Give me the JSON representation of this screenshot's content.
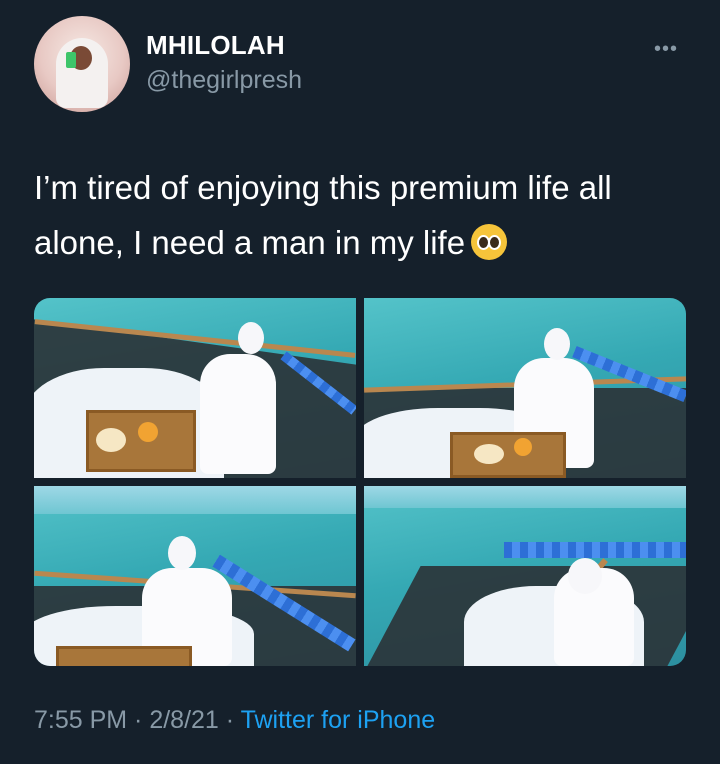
{
  "user": {
    "display_name": "MHILOLAH",
    "handle": "@thegirlpresh",
    "avatar_icon": "profile-photo"
  },
  "menu": {
    "more_icon": "more-dots-icon",
    "more_glyph": "•••"
  },
  "tweet": {
    "text": "I’m tired of enjoying this premium life all alone, I need a man in my life",
    "emoji_icon": "pleading-face-emoji"
  },
  "media": {
    "photos": [
      {
        "description_icon": "photo-floating-breakfast-1"
      },
      {
        "description_icon": "photo-floating-breakfast-2"
      },
      {
        "description_icon": "photo-floating-breakfast-3"
      },
      {
        "description_icon": "photo-floating-breakfast-4"
      }
    ]
  },
  "footer": {
    "time": "7:55 PM",
    "separator": " · ",
    "date": "2/8/21",
    "source": "Twitter for iPhone"
  },
  "colors": {
    "background": "#15202b",
    "secondary_text": "#8899a6",
    "link": "#1da1f2"
  }
}
